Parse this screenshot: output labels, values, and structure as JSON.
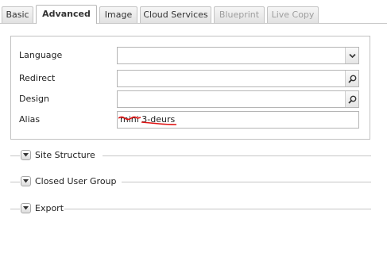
{
  "tabs": [
    {
      "label": "Basic",
      "state": "normal"
    },
    {
      "label": "Advanced",
      "state": "active"
    },
    {
      "label": "Image",
      "state": "normal"
    },
    {
      "label": "Cloud Services",
      "state": "normal"
    },
    {
      "label": "Blueprint",
      "state": "disabled"
    },
    {
      "label": "Live Copy",
      "state": "disabled"
    }
  ],
  "form": {
    "language": {
      "label": "Language",
      "value": "",
      "icon": "chevron-down-icon"
    },
    "redirect": {
      "label": "Redirect",
      "value": "",
      "icon": "search-icon"
    },
    "design": {
      "label": "Design",
      "value": "",
      "icon": "search-icon"
    },
    "alias": {
      "label": "Alias",
      "value": "mini 3-deurs",
      "annotation_color": "#e01515"
    }
  },
  "sections": [
    {
      "title": "Site Structure",
      "icon": "chevron-down-icon"
    },
    {
      "title": "Closed User Group",
      "icon": "chevron-down-icon"
    },
    {
      "title": "Export",
      "icon": "chevron-down-icon"
    }
  ],
  "colors": {
    "border": "#c2c2c2",
    "tab_gradient_top": "#f6f6f6",
    "tab_gradient_bottom": "#e2e2e2",
    "annotation": "#e01515"
  }
}
